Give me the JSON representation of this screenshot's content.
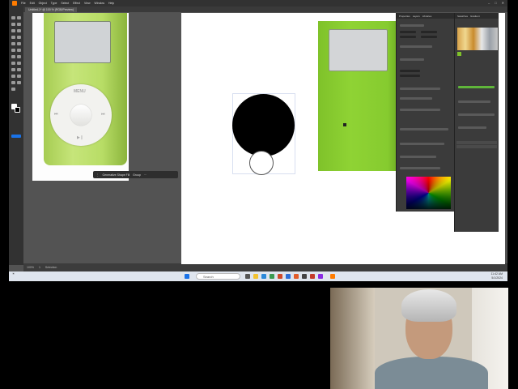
{
  "menubar": {
    "items": [
      "File",
      "Edit",
      "Object",
      "Type",
      "Select",
      "Effect",
      "View",
      "Window",
      "Help"
    ]
  },
  "document": {
    "tab_label": "Untitled-1* @ 100 % (RGB/Preview)"
  },
  "reference": {
    "menu_label": "MENU",
    "prev_label": "⏮",
    "next_label": "⏭",
    "play_label": "▶❙"
  },
  "contextbar": {
    "label_a": "Generative Shape Fill",
    "label_b": "Group"
  },
  "colors": {
    "green_body": "#86cb2f",
    "reference_green": "#b8dd66",
    "screen_gray": "#d3d5d7",
    "illustrator_accent": "#ff7c00"
  },
  "panels": {
    "props_tabs": [
      "Properties",
      "Layers",
      "Libraries"
    ],
    "swatch_tabs": [
      "Swatches",
      "Gradient"
    ]
  },
  "taskbar": {
    "search_placeholder": "Search",
    "time": "11:42 AM",
    "date": "5/1/2024"
  }
}
